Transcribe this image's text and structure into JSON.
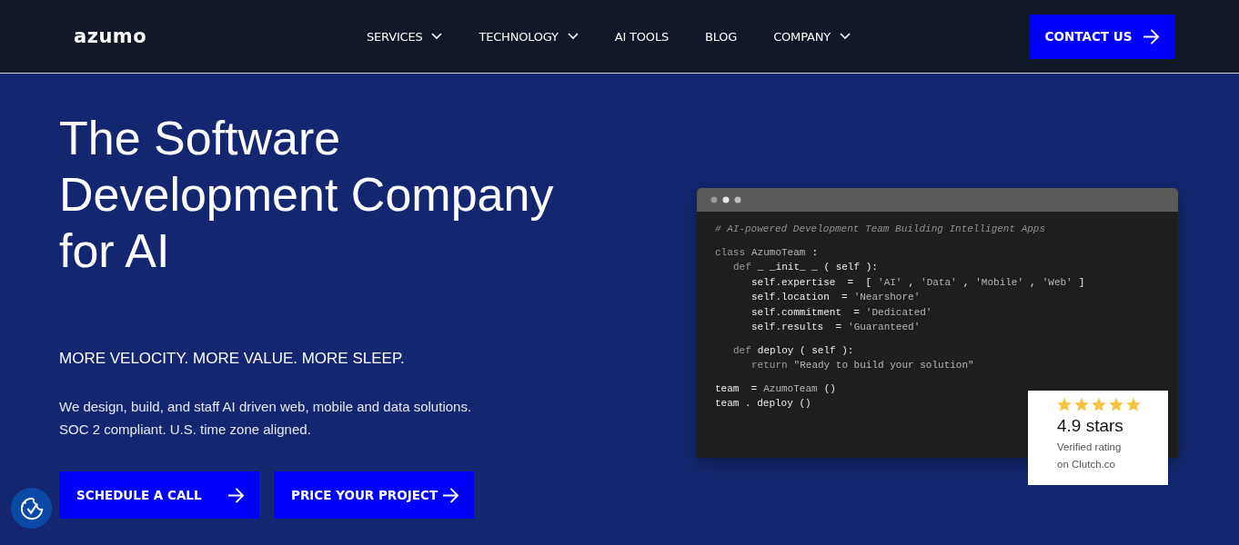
{
  "nav": {
    "logo": "azumo",
    "items": [
      {
        "label": "SERVICES",
        "dropdown": true
      },
      {
        "label": "TECHNOLOGY",
        "dropdown": true
      },
      {
        "label": "AI TOOLS",
        "dropdown": false
      },
      {
        "label": "BLOG",
        "dropdown": false
      },
      {
        "label": "COMPANY",
        "dropdown": true
      }
    ],
    "cta": "CONTACT US"
  },
  "hero": {
    "title_lines": [
      "The Software",
      "Development Company",
      "for AI"
    ],
    "tagline": "MORE VELOCITY. MORE VALUE. MORE SLEEP.",
    "description_lines": [
      "We design, build, and staff AI driven web, mobile and data solutions.",
      "SOC 2 compliant. U.S. time zone aligned."
    ],
    "buttons": [
      "SCHEDULE A CALL",
      "PRICE YOUR PROJECT"
    ]
  },
  "code": {
    "lines": [
      {
        "tokens": [
          {
            "kind": "comment",
            "text": "# AI-powered Development Team Building Intelligent Apps"
          }
        ]
      },
      {
        "tokens": [
          {
            "kind": "keyword",
            "text": "class"
          },
          {
            "kind": "name",
            "text": "AzumoTeam"
          },
          {
            "kind": "plain",
            "text": ":"
          }
        ],
        "children": [
          {
            "tokens": [
              {
                "kind": "keyword",
                "text": "def"
              },
              {
                "kind": "plain",
                "text": "_ _init_ _ ( self ):"
              }
            ],
            "children": [
              {
                "tokens": [
                  {
                    "kind": "plain",
                    "text": "self.expertise  =  ["
                  },
                  {
                    "kind": "string",
                    "text": "'AI'"
                  },
                  {
                    "kind": "plain",
                    "text": ","
                  },
                  {
                    "kind": "string",
                    "text": "'Data'"
                  },
                  {
                    "kind": "plain",
                    "text": ","
                  },
                  {
                    "kind": "string",
                    "text": "'Mobile'"
                  },
                  {
                    "kind": "plain",
                    "text": ","
                  },
                  {
                    "kind": "string",
                    "text": "'Web'"
                  },
                  {
                    "kind": "plain",
                    "text": "]"
                  }
                ]
              },
              {
                "tokens": [
                  {
                    "kind": "plain",
                    "text": "self.location  ="
                  },
                  {
                    "kind": "string",
                    "text": "'Nearshore'"
                  }
                ]
              },
              {
                "tokens": [
                  {
                    "kind": "plain",
                    "text": "self.commitment  ="
                  },
                  {
                    "kind": "string",
                    "text": "'Dedicated'"
                  }
                ]
              },
              {
                "tokens": [
                  {
                    "kind": "plain",
                    "text": "self.results  ="
                  },
                  {
                    "kind": "string",
                    "text": "'Guaranteed'"
                  }
                ]
              }
            ]
          },
          {
            "tokens": [
              {
                "kind": "keyword",
                "text": "def"
              },
              {
                "kind": "plain",
                "text": "deploy ( self ):"
              }
            ],
            "children": [
              {
                "tokens": [
                  {
                    "kind": "keyword",
                    "text": "return"
                  },
                  {
                    "kind": "string",
                    "text": "\"Ready to build your solution\""
                  }
                ]
              }
            ]
          }
        ]
      },
      {
        "tokens": [
          {
            "kind": "plain",
            "text": "team  ="
          },
          {
            "kind": "name",
            "text": "AzumoTeam"
          },
          {
            "kind": "plain",
            "text": "()"
          }
        ]
      },
      {
        "tokens": [
          {
            "kind": "plain",
            "text": "team . deploy ()"
          }
        ]
      }
    ]
  },
  "rating": {
    "stars": 5,
    "score": "4.9 stars",
    "note_lines": [
      "Verified rating",
      "on Clutch.co"
    ]
  }
}
